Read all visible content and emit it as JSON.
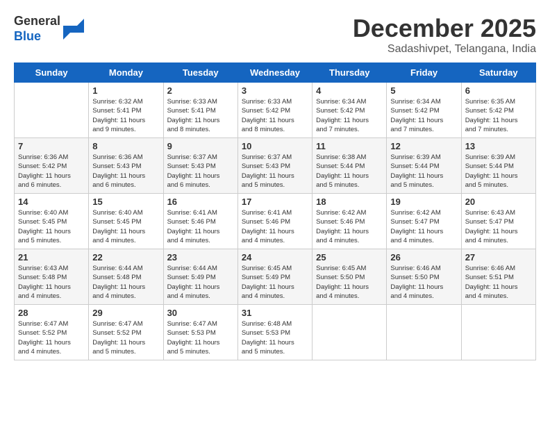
{
  "header": {
    "logo_line1": "General",
    "logo_line2": "Blue",
    "month": "December 2025",
    "location": "Sadashivpet, Telangana, India"
  },
  "days_of_week": [
    "Sunday",
    "Monday",
    "Tuesday",
    "Wednesday",
    "Thursday",
    "Friday",
    "Saturday"
  ],
  "weeks": [
    [
      {
        "date": "",
        "info": ""
      },
      {
        "date": "1",
        "info": "Sunrise: 6:32 AM\nSunset: 5:41 PM\nDaylight: 11 hours\nand 9 minutes."
      },
      {
        "date": "2",
        "info": "Sunrise: 6:33 AM\nSunset: 5:41 PM\nDaylight: 11 hours\nand 8 minutes."
      },
      {
        "date": "3",
        "info": "Sunrise: 6:33 AM\nSunset: 5:42 PM\nDaylight: 11 hours\nand 8 minutes."
      },
      {
        "date": "4",
        "info": "Sunrise: 6:34 AM\nSunset: 5:42 PM\nDaylight: 11 hours\nand 7 minutes."
      },
      {
        "date": "5",
        "info": "Sunrise: 6:34 AM\nSunset: 5:42 PM\nDaylight: 11 hours\nand 7 minutes."
      },
      {
        "date": "6",
        "info": "Sunrise: 6:35 AM\nSunset: 5:42 PM\nDaylight: 11 hours\nand 7 minutes."
      }
    ],
    [
      {
        "date": "7",
        "info": "Sunrise: 6:36 AM\nSunset: 5:42 PM\nDaylight: 11 hours\nand 6 minutes."
      },
      {
        "date": "8",
        "info": "Sunrise: 6:36 AM\nSunset: 5:43 PM\nDaylight: 11 hours\nand 6 minutes."
      },
      {
        "date": "9",
        "info": "Sunrise: 6:37 AM\nSunset: 5:43 PM\nDaylight: 11 hours\nand 6 minutes."
      },
      {
        "date": "10",
        "info": "Sunrise: 6:37 AM\nSunset: 5:43 PM\nDaylight: 11 hours\nand 5 minutes."
      },
      {
        "date": "11",
        "info": "Sunrise: 6:38 AM\nSunset: 5:44 PM\nDaylight: 11 hours\nand 5 minutes."
      },
      {
        "date": "12",
        "info": "Sunrise: 6:39 AM\nSunset: 5:44 PM\nDaylight: 11 hours\nand 5 minutes."
      },
      {
        "date": "13",
        "info": "Sunrise: 6:39 AM\nSunset: 5:44 PM\nDaylight: 11 hours\nand 5 minutes."
      }
    ],
    [
      {
        "date": "14",
        "info": "Sunrise: 6:40 AM\nSunset: 5:45 PM\nDaylight: 11 hours\nand 5 minutes."
      },
      {
        "date": "15",
        "info": "Sunrise: 6:40 AM\nSunset: 5:45 PM\nDaylight: 11 hours\nand 4 minutes."
      },
      {
        "date": "16",
        "info": "Sunrise: 6:41 AM\nSunset: 5:46 PM\nDaylight: 11 hours\nand 4 minutes."
      },
      {
        "date": "17",
        "info": "Sunrise: 6:41 AM\nSunset: 5:46 PM\nDaylight: 11 hours\nand 4 minutes."
      },
      {
        "date": "18",
        "info": "Sunrise: 6:42 AM\nSunset: 5:46 PM\nDaylight: 11 hours\nand 4 minutes."
      },
      {
        "date": "19",
        "info": "Sunrise: 6:42 AM\nSunset: 5:47 PM\nDaylight: 11 hours\nand 4 minutes."
      },
      {
        "date": "20",
        "info": "Sunrise: 6:43 AM\nSunset: 5:47 PM\nDaylight: 11 hours\nand 4 minutes."
      }
    ],
    [
      {
        "date": "21",
        "info": "Sunrise: 6:43 AM\nSunset: 5:48 PM\nDaylight: 11 hours\nand 4 minutes."
      },
      {
        "date": "22",
        "info": "Sunrise: 6:44 AM\nSunset: 5:48 PM\nDaylight: 11 hours\nand 4 minutes."
      },
      {
        "date": "23",
        "info": "Sunrise: 6:44 AM\nSunset: 5:49 PM\nDaylight: 11 hours\nand 4 minutes."
      },
      {
        "date": "24",
        "info": "Sunrise: 6:45 AM\nSunset: 5:49 PM\nDaylight: 11 hours\nand 4 minutes."
      },
      {
        "date": "25",
        "info": "Sunrise: 6:45 AM\nSunset: 5:50 PM\nDaylight: 11 hours\nand 4 minutes."
      },
      {
        "date": "26",
        "info": "Sunrise: 6:46 AM\nSunset: 5:50 PM\nDaylight: 11 hours\nand 4 minutes."
      },
      {
        "date": "27",
        "info": "Sunrise: 6:46 AM\nSunset: 5:51 PM\nDaylight: 11 hours\nand 4 minutes."
      }
    ],
    [
      {
        "date": "28",
        "info": "Sunrise: 6:47 AM\nSunset: 5:52 PM\nDaylight: 11 hours\nand 4 minutes."
      },
      {
        "date": "29",
        "info": "Sunrise: 6:47 AM\nSunset: 5:52 PM\nDaylight: 11 hours\nand 5 minutes."
      },
      {
        "date": "30",
        "info": "Sunrise: 6:47 AM\nSunset: 5:53 PM\nDaylight: 11 hours\nand 5 minutes."
      },
      {
        "date": "31",
        "info": "Sunrise: 6:48 AM\nSunset: 5:53 PM\nDaylight: 11 hours\nand 5 minutes."
      },
      {
        "date": "",
        "info": ""
      },
      {
        "date": "",
        "info": ""
      },
      {
        "date": "",
        "info": ""
      }
    ]
  ]
}
